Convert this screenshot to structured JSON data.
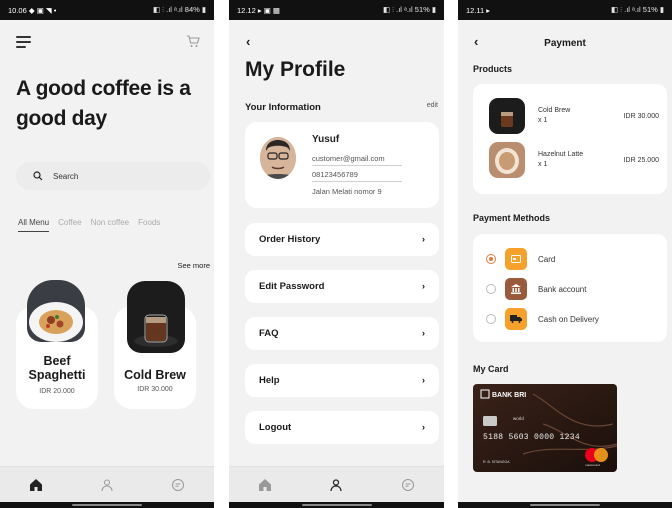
{
  "home": {
    "status_left": "10.06 ◆ ▣ ◥ •",
    "status_right": "◧ ⫶ .ıl ᵃ.ıl 84% ▮",
    "headline": "A good coffee is a good day",
    "search_placeholder": "Search",
    "categories": [
      "All Menu",
      "Coffee",
      "Non coffee",
      "Foods"
    ],
    "see_more": "See more",
    "products": [
      {
        "name": "Beef Spaghetti",
        "price": "IDR 20.000"
      },
      {
        "name": "Cold Brew",
        "price": "IDR 30.000"
      }
    ]
  },
  "profile": {
    "status_left": "12.12 ▸ ▣ ▦",
    "status_right": "◧ ⫶ .ıl ᵃ.ıl 51% ▮",
    "title": "My Profile",
    "section_label": "Your Information",
    "edit_label": "edit",
    "user": {
      "name": "Yusuf",
      "email": "customer@gmail.com",
      "phone": "08123456789",
      "address": "Jalan Melati nomor 9"
    },
    "options": [
      "Order History",
      "Edit Password",
      "FAQ",
      "Help",
      "Logout"
    ]
  },
  "payment": {
    "status_left": "12.11 ▸",
    "status_right": "◧ ⫶ .ıl ᵃ.ıl 51% ▮",
    "title": "Payment",
    "products_label": "Products",
    "items": [
      {
        "name": "Cold Brew",
        "qty": "x 1",
        "price": "IDR 30.000"
      },
      {
        "name": "Hazelnut Latte",
        "qty": "x 1",
        "price": "IDR 25.000"
      }
    ],
    "methods_label": "Payment Methods",
    "methods": [
      {
        "label": "Card",
        "selected": true,
        "icon": "card-icon"
      },
      {
        "label": "Bank account",
        "selected": false,
        "icon": "bank-icon"
      },
      {
        "label": "Cash on Delivery",
        "selected": false,
        "icon": "delivery-truck-icon"
      }
    ],
    "my_card_label": "My Card",
    "card": {
      "bank": "BANK BRI",
      "number": "5188 5603 0000 1234",
      "holder": "R. B. SITANGGA",
      "valid_label": "world",
      "brand": "mastercard"
    }
  },
  "colors": {
    "accent": "#F5A12B",
    "card_orange": "#E8853A",
    "bank_brown": "#9A5B3C",
    "background": "#F2F2F2"
  }
}
